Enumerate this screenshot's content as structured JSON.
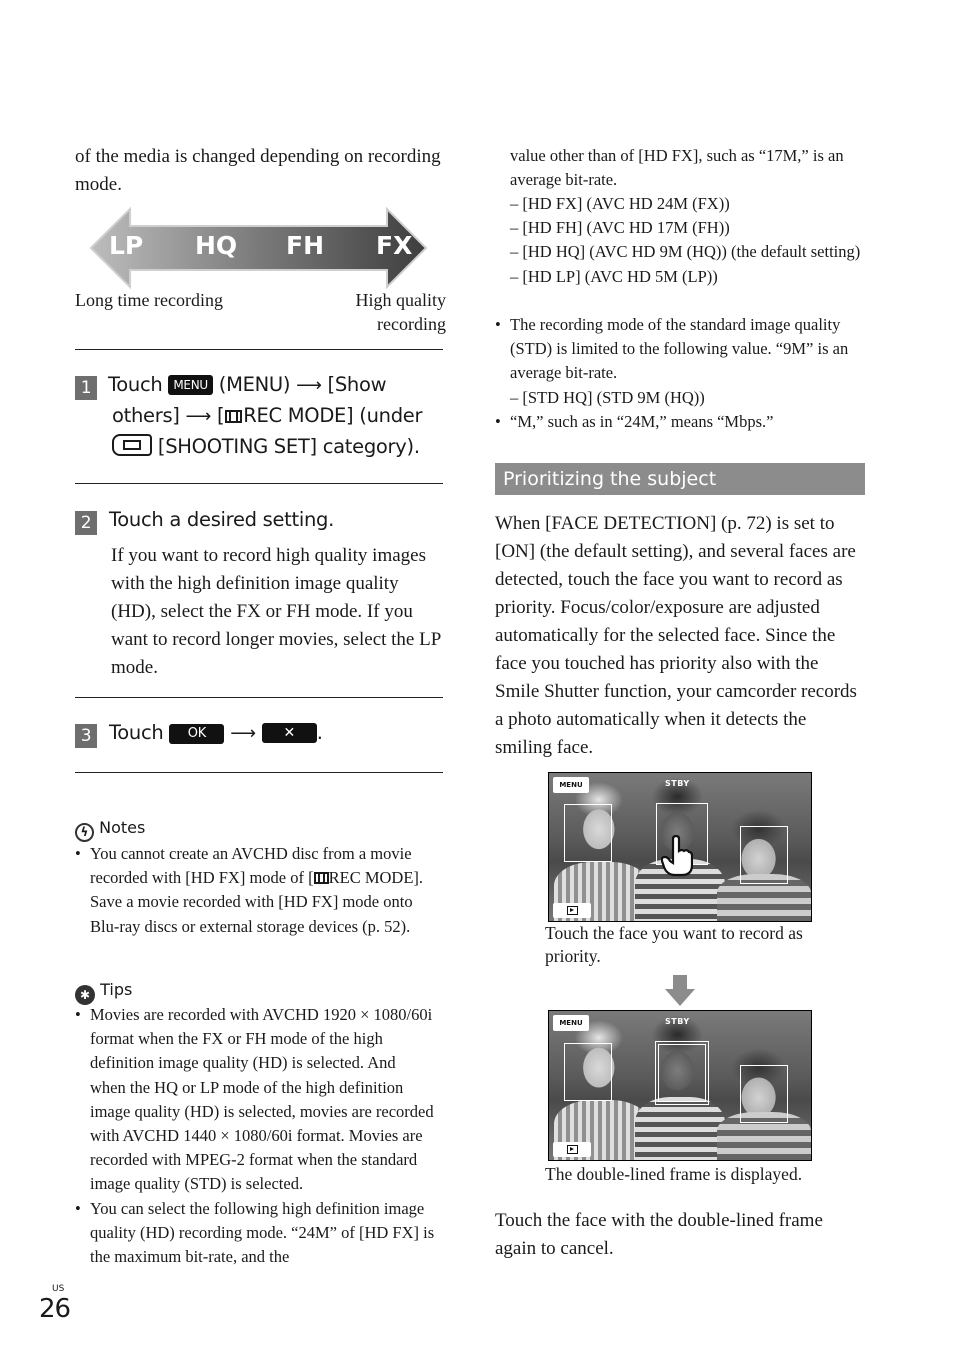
{
  "left_column": {
    "intro_text": "of the media is changed depending on recording mode.",
    "mode_scale": {
      "modes": [
        "LP",
        "HQ",
        "FH",
        "FX"
      ],
      "left_label": "Long time recording",
      "right_label_line1": "High quality",
      "right_label_line2": "recording"
    },
    "step1": {
      "number": "1",
      "touch": "Touch",
      "menu_button": "MENU",
      "part1": "(MENU)",
      "part2": "[Show",
      "part3": "others]",
      "part4": "[",
      "part5": "REC MODE] (under",
      "part6": "[SHOOTING SET] category)."
    },
    "step2": {
      "number": "2",
      "title": "Touch a desired setting.",
      "body": "If you want to record high quality images with the high definition image quality (HD), select the FX or FH mode. If you want to record longer movies, select the LP mode."
    },
    "step3": {
      "number": "3",
      "touch": "Touch",
      "ok_button": "OK",
      "close_button": "✕",
      "end": "."
    },
    "notes": {
      "heading": "Notes",
      "item_part1": "You cannot create an AVCHD disc from a movie recorded with [HD FX] mode of [",
      "item_part2": "REC MODE]. Save a movie recorded with [HD FX] mode onto Blu-ray discs or external storage devices (p. 52)."
    },
    "tips": {
      "heading": "Tips",
      "items": [
        "Movies are recorded with AVCHD 1920 × 1080/60i format when the FX or FH mode of the high definition image quality (HD) is selected. And when the HQ or LP mode of the high definition image quality (HD) is selected, movies are recorded with AVCHD 1440 × 1080/60i format. Movies are recorded with MPEG-2 format when the standard image quality (STD) is selected.",
        "You can select the following high definition image quality (HD) recording mode. “24M” of [HD FX] is the maximum bit-rate, and the"
      ]
    }
  },
  "right_column": {
    "cont_text": "value other than of [HD FX], such as “17M,” is an average bit-rate.",
    "hd_modes": [
      "– [HD FX] (AVC HD 24M (FX))",
      "– [HD FH] (AVC HD 17M (FH))",
      "– [HD HQ] (AVC HD 9M (HQ)) (the default setting)",
      "– [HD LP] (AVC HD 5M (LP))"
    ],
    "std_bullet": "The recording mode of the standard image quality (STD) is limited to the following value. “9M” is an average bit-rate.",
    "std_modes": [
      "– [STD HQ] (STD 9M (HQ))"
    ],
    "m_bullet": "“M,” such as in “24M,” means “Mbps.”",
    "section_heading": "Prioritizing the subject",
    "section_body": "When [FACE DETECTION] (p. 72) is set to [ON] (the default setting), and several faces are detected, touch the face you want to record as priority. Focus/color/exposure are adjusted automatically for the selected face. Since the face you touched has priority also with the Smile Shutter function, your camcorder records a photo automatically when it detects the smiling face.",
    "screen1": {
      "menu_label": "MENU",
      "status": "STBY",
      "caption": "Touch the face you want to record as priority."
    },
    "screen2": {
      "menu_label": "MENU",
      "status": "STBY",
      "caption": "The double-lined frame is displayed."
    },
    "closing_text": "Touch the face with the double-lined frame again to cancel."
  },
  "footer": {
    "region": "US",
    "page_number": "26"
  }
}
